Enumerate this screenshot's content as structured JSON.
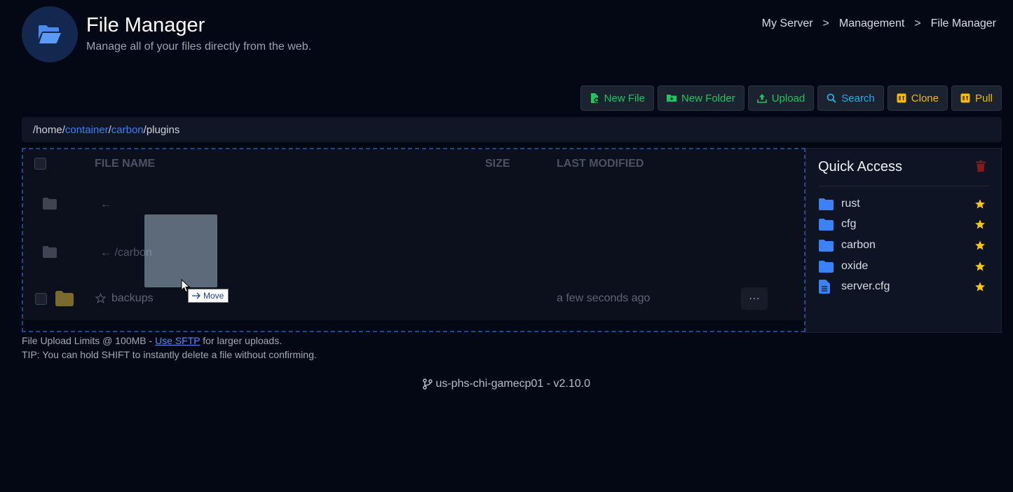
{
  "header": {
    "title": "File Manager",
    "subtitle": "Manage all of your files directly from the web.",
    "icon": "folder-open-icon",
    "breadcrumb": [
      "My Server",
      "Management",
      "File Manager"
    ],
    "breadcrumb_separator": ">"
  },
  "toolbar": {
    "new_file": "New File",
    "new_folder": "New Folder",
    "upload": "Upload",
    "search": "Search",
    "clone": "Clone",
    "pull": "Pull"
  },
  "path": {
    "root": "/",
    "home": "home",
    "container": "container",
    "carbon": "carbon",
    "current": "plugins",
    "separator": "/"
  },
  "table": {
    "col_name": "FILE NAME",
    "col_size": "SIZE",
    "col_modified": "LAST MODIFIED",
    "rows": [
      {
        "name": "←",
        "size": "",
        "modified": ""
      },
      {
        "name": "← /carbon",
        "size": "",
        "modified": ""
      },
      {
        "name": "backups",
        "size": "",
        "modified": "a few seconds ago"
      }
    ]
  },
  "drag": {
    "tooltip": "Move"
  },
  "quick_access": {
    "title": "Quick Access",
    "items": [
      {
        "name": "rust",
        "icon": "folder-icon"
      },
      {
        "name": "cfg",
        "icon": "folder-icon"
      },
      {
        "name": "carbon",
        "icon": "folder-icon"
      },
      {
        "name": "oxide",
        "icon": "folder-icon"
      },
      {
        "name": "server.cfg",
        "icon": "file-icon"
      }
    ]
  },
  "notes": {
    "upload_prefix": "File Upload Limits @ 100MB - ",
    "sftp_link": "Use SFTP",
    "upload_suffix": " for larger uploads.",
    "tip": "TIP: You can hold SHIFT to instantly delete a file without confirming."
  },
  "footer": {
    "node": "us-phs-chi-gamecp01 - v2.10.0"
  },
  "colors": {
    "accent": "#3b82f6",
    "green": "#22c55e",
    "cyan": "#22aee6",
    "yellow": "#f5b90a",
    "background": "#040714"
  }
}
